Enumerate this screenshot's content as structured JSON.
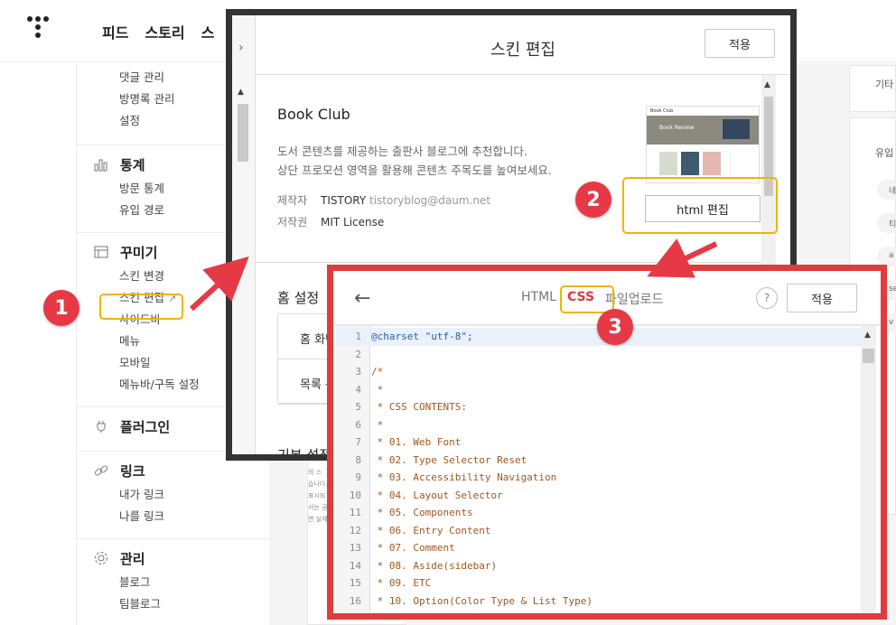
{
  "topnav": {
    "items": [
      "피드",
      "스토리",
      "스"
    ]
  },
  "sidebar": {
    "top_items": [
      "댓글 관리",
      "방명록 관리",
      "설정"
    ],
    "stats": {
      "title": "통계",
      "items": [
        "방문 통계",
        "유입 경로"
      ]
    },
    "decorate": {
      "title": "꾸미기",
      "items": [
        "스킨 변경",
        "스킨 편집",
        "사이드바",
        "메뉴",
        "모바일",
        "메뉴바/구독 설정"
      ]
    },
    "plugin": {
      "title": "플러그인"
    },
    "link": {
      "title": "링크",
      "items": [
        "내가 링크",
        "나를 링크"
      ]
    },
    "manage": {
      "title": "관리",
      "items": [
        "블로그",
        "팀블로그"
      ]
    }
  },
  "skin_panel": {
    "title": "스킨 편집",
    "apply": "적용",
    "theme_name": "Book Club",
    "desc_line1": "도서 콘텐츠를 제공하는 출판사 블로그에 추천합니다.",
    "desc_line2": "상단 프로모션 영역을 활용해 콘텐츠 주목도를 높여보세요.",
    "maker_label": "제작자",
    "maker_name": "TISTORY",
    "maker_email": "tistoryblog@daum.net",
    "license_label": "저작권",
    "license_value": "MIT License",
    "html_edit": "html 편집",
    "home_setting": "홈 설정",
    "home_rows": [
      "홈 화면",
      "목록 구"
    ],
    "basic_setting": "기본 설정",
    "thumb_title": "Book Club",
    "thumb_banner": "Book Review"
  },
  "code_panel": {
    "tabs": [
      "HTML",
      "CSS",
      "파일업로드"
    ],
    "active_tab": "CSS",
    "help": "?",
    "apply": "적용",
    "lines": [
      {
        "n": "1",
        "t": "@charset \"utf-8\";"
      },
      {
        "n": "2",
        "t": ""
      },
      {
        "n": "3",
        "t": "/*"
      },
      {
        "n": "4",
        "t": " *"
      },
      {
        "n": "5",
        "t": " * CSS CONTENTS:"
      },
      {
        "n": "6",
        "t": " *"
      },
      {
        "n": "7",
        "t": " * 01. Web Font"
      },
      {
        "n": "8",
        "t": " * 02. Type Selector Reset"
      },
      {
        "n": "9",
        "t": " * 03. Accessibility Navigation"
      },
      {
        "n": "10",
        "t": " * 04. Layout Selector"
      },
      {
        "n": "11",
        "t": " * 05. Components"
      },
      {
        "n": "12",
        "t": " * 06. Entry Content"
      },
      {
        "n": "13",
        "t": " * 07. Comment"
      },
      {
        "n": "14",
        "t": " * 08. Aside(sidebar)"
      },
      {
        "n": "15",
        "t": " * 09. ETC"
      },
      {
        "n": "16",
        "t": " * 10. Option(Color Type & List Type)"
      }
    ]
  },
  "right_col": {
    "card1": "기타",
    "card2_title": "유입",
    "pills": [
      "네",
      "티",
      "a",
      "se",
      "v"
    ]
  },
  "bg_card_text": [
    "의 스",
    "습니다.",
    "표시되",
    "서는 공",
    "면 실제"
  ],
  "badges": [
    "1",
    "2",
    "3"
  ],
  "colors": {
    "badge": "#e63946",
    "callout": "#f0b400",
    "active_tab": "#e03c3c",
    "frame_dark": "#333333",
    "frame_red": "#e03c3c"
  }
}
